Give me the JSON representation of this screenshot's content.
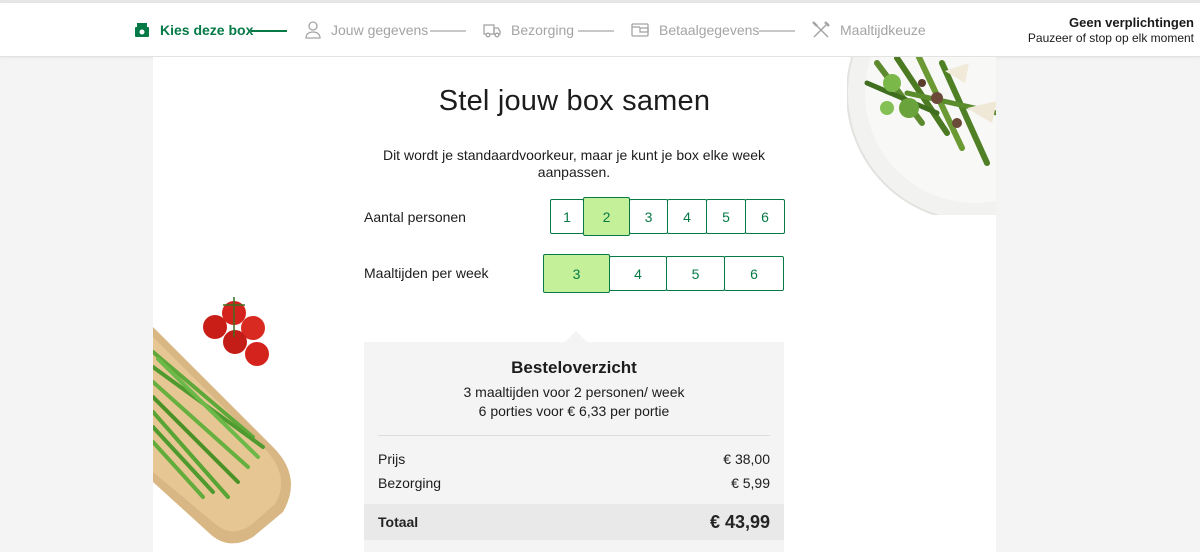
{
  "header": {
    "steps": [
      {
        "label": "Kies deze box",
        "icon": "box-icon"
      },
      {
        "label": "Jouw gegevens",
        "icon": "user-icon"
      },
      {
        "label": "Bezorging",
        "icon": "truck-icon"
      },
      {
        "label": "Betaalgegevens",
        "icon": "wallet-icon"
      },
      {
        "label": "Maaltijdkeuze",
        "icon": "cutlery-icon"
      }
    ],
    "active_step": 0,
    "right_title": "Geen verplichtingen",
    "right_subtitle": "Pauzeer of stop op elk moment"
  },
  "main": {
    "title": "Stel jouw box samen",
    "subtitle": "Dit wordt je standaardvoorkeur, maar je kunt je box elke week aanpassen.",
    "persons": {
      "label": "Aantal personen",
      "options": [
        "1",
        "2",
        "3",
        "4",
        "5",
        "6"
      ],
      "selected": "2"
    },
    "meals": {
      "label": "Maaltijden per week",
      "options": [
        "3",
        "4",
        "5",
        "6"
      ],
      "selected": "3"
    }
  },
  "summary": {
    "title": "Besteloverzicht",
    "line1": "3 maaltijden voor 2 personen/ week",
    "line2": "6 porties voor € 6,33 per portie",
    "price_label": "Prijs",
    "price_value": "€ 38,00",
    "delivery_label": "Bezorging",
    "delivery_value": "€ 5,99",
    "total_label": "Totaal",
    "total_value": "€ 43,99"
  },
  "colors": {
    "brand_green": "#067a46",
    "selected_fill": "#c4f09a",
    "summary_bg": "#f4f4f4"
  }
}
